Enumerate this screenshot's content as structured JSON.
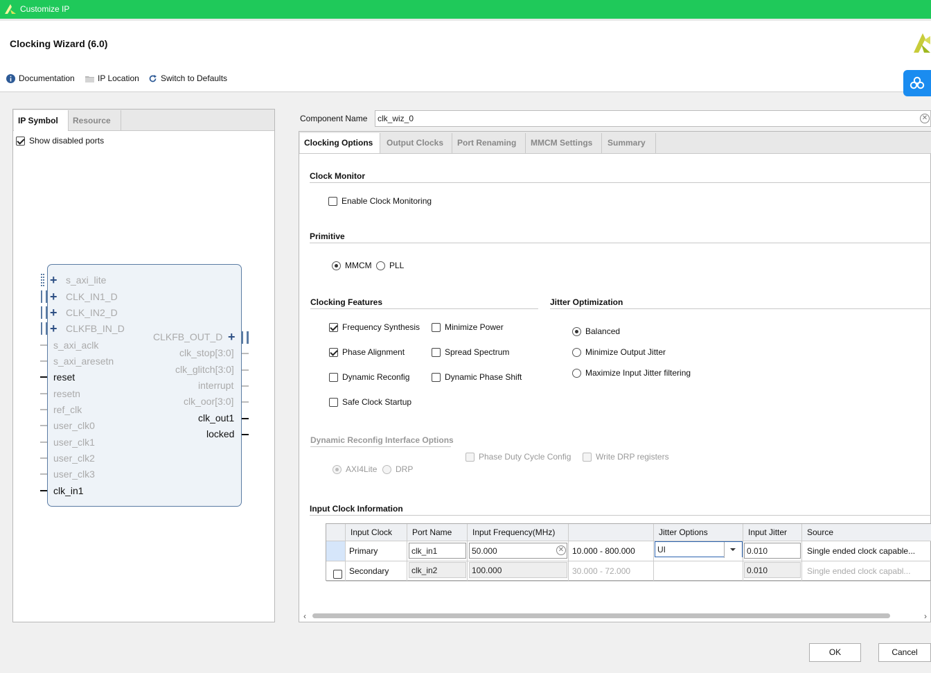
{
  "window": {
    "title": "Customize IP",
    "app_icon": "xilinx-logo-icon"
  },
  "header": {
    "page_title": "Clocking Wizard (6.0)",
    "logo": "xilinx-logo-icon"
  },
  "toolbar": {
    "documentation": "Documentation",
    "ip_location": "IP Location",
    "switch_defaults": "Switch to Defaults"
  },
  "left_panel": {
    "tabs": [
      "IP Symbol",
      "Resource"
    ],
    "show_disabled_ports": "Show disabled ports",
    "show_disabled_checked": true,
    "inputs": [
      "s_axi_lite",
      "CLK_IN1_D",
      "CLK_IN2_D",
      "CLKFB_IN_D",
      "s_axi_aclk",
      "s_axi_aresetn",
      "reset",
      "resetn",
      "ref_clk",
      "user_clk0",
      "user_clk1",
      "user_clk2",
      "user_clk3",
      "clk_in1"
    ],
    "outputs": [
      "CLKFB_OUT_D",
      "clk_stop[3:0]",
      "clk_glitch[3:0]",
      "interrupt",
      "clk_oor[3:0]",
      "clk_out1",
      "locked"
    ]
  },
  "component": {
    "label": "Component Name",
    "value": "clk_wiz_0"
  },
  "tabs": [
    "Clocking Options",
    "Output Clocks",
    "Port Renaming",
    "MMCM Settings",
    "Summary"
  ],
  "clock_monitor": {
    "title": "Clock Monitor",
    "enable": "Enable Clock Monitoring",
    "enable_checked": false
  },
  "primitive": {
    "title": "Primitive",
    "options": [
      "MMCM",
      "PLL"
    ],
    "selected": "MMCM"
  },
  "clocking_features": {
    "title": "Clocking Features",
    "frequency_synthesis": "Frequency Synthesis",
    "minimize_power": "Minimize Power",
    "phase_alignment": "Phase Alignment",
    "spread_spectrum": "Spread Spectrum",
    "dynamic_reconfig": "Dynamic Reconfig",
    "dynamic_phase_shift": "Dynamic Phase Shift",
    "safe_clock_startup": "Safe Clock Startup",
    "checked": [
      "Frequency Synthesis",
      "Phase Alignment"
    ]
  },
  "jitter_optimization": {
    "title": "Jitter Optimization",
    "options": [
      "Balanced",
      "Minimize Output Jitter",
      "Maximize Input Jitter filtering"
    ],
    "selected": "Balanced"
  },
  "dynamic_reconfig_iface": {
    "title": "Dynamic Reconfig Interface Options",
    "options": [
      "AXI4Lite",
      "DRP"
    ],
    "phase_duty": "Phase Duty Cycle Config",
    "write_drp": "Write DRP registers"
  },
  "input_clock_info": {
    "title": "Input Clock Information",
    "headers": [
      "Input Clock",
      "Port Name",
      "Input Frequency(MHz)",
      "",
      "Jitter Options",
      "Input Jitter",
      "Source"
    ],
    "rows": [
      {
        "clock": "Primary",
        "port": "clk_in1",
        "freq": "50.000",
        "range": "10.000 - 800.000",
        "jitter_opt": "UI",
        "jitter": "0.010",
        "source": "Single ended clock capable..."
      },
      {
        "clock": "Secondary",
        "port": "clk_in2",
        "freq": "100.000",
        "range": "30.000 - 72.000",
        "jitter_opt": "",
        "jitter": "0.010",
        "source": "Single ended clock capabl..."
      }
    ]
  },
  "buttons": {
    "ok": "OK",
    "cancel": "Cancel"
  }
}
